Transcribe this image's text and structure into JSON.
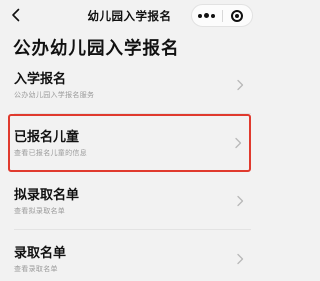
{
  "navbar": {
    "title": "幼儿园入学报名",
    "back_icon": "chevron-left-icon",
    "more_icon": "more-dots-icon",
    "close_icon": "target-close-icon"
  },
  "page": {
    "title": "公办幼儿园入学报名"
  },
  "menu": {
    "items": [
      {
        "label": "入学报名",
        "desc": "公办幼儿园入学报名服务",
        "selected": false
      },
      {
        "label": "已报名儿童",
        "desc": "查看已报名儿童的信息",
        "selected": true
      },
      {
        "label": "拟录取名单",
        "desc": "查看拟录取名单",
        "selected": false
      },
      {
        "label": "录取名单",
        "desc": "查看录取名单",
        "selected": false
      }
    ]
  },
  "colors": {
    "background": "#f2f2f2",
    "highlight_border": "#e03a2e",
    "text_primary": "#111111",
    "text_secondary": "#9a9a9a"
  }
}
